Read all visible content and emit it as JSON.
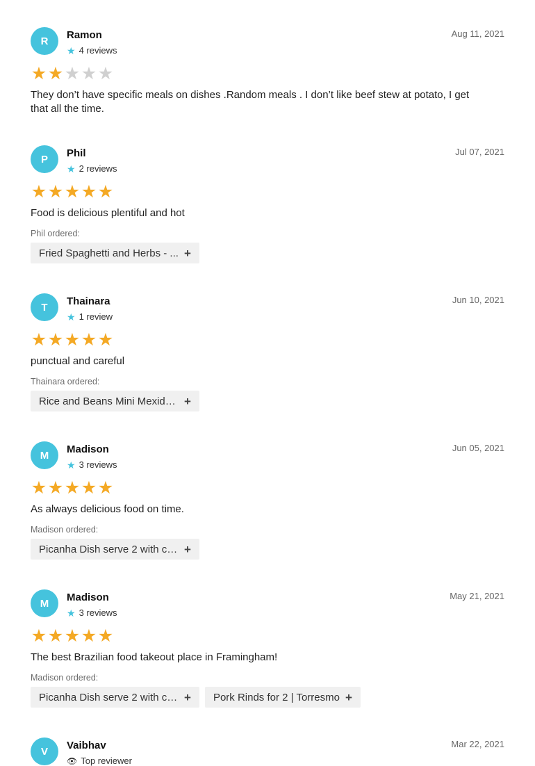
{
  "reviews": [
    {
      "initial": "R",
      "name": "Ramon",
      "meta_icon": "star-icon",
      "meta": "4 reviews",
      "date": "Aug 11, 2021",
      "rating": 2,
      "text": "They don’t have specific meals on dishes .Random meals . I don’t like beef stew at potato, I get that all the time.",
      "ordered_label": "",
      "items": []
    },
    {
      "initial": "P",
      "name": "Phil",
      "meta_icon": "star-icon",
      "meta": "2 reviews",
      "date": "Jul 07, 2021",
      "rating": 5,
      "text": "Food is delicious plentiful and hot",
      "ordered_label": "Phil ordered:",
      "items": [
        {
          "label": "Fried Spaghetti and Herbs - ...",
          "truncated": true
        }
      ]
    },
    {
      "initial": "T",
      "name": "Thainara",
      "meta_icon": "star-icon",
      "meta": "1 review",
      "date": "Jun 10, 2021",
      "rating": 5,
      "text": "punctual and careful",
      "ordered_label": "Thainara ordered:",
      "items": [
        {
          "label": "Rice and Beans Mini Mexidã...",
          "truncated": true
        }
      ]
    },
    {
      "initial": "M",
      "name": "Madison",
      "meta_icon": "star-icon",
      "meta": "3 reviews",
      "date": "Jun 05, 2021",
      "rating": 5,
      "text": "As always delicious food on time.",
      "ordered_label": "Madison ordered:",
      "items": [
        {
          "label": "Picanha Dish serve 2 with ca...",
          "truncated": true
        }
      ]
    },
    {
      "initial": "M",
      "name": "Madison",
      "meta_icon": "star-icon",
      "meta": "3 reviews",
      "date": "May 21, 2021",
      "rating": 5,
      "text": "The best Brazilian food takeout place in Framingham!",
      "ordered_label": "Madison ordered:",
      "items": [
        {
          "label": "Picanha Dish serve 2 with ca...",
          "truncated": true
        },
        {
          "label": "Pork Rinds for 2 | Torresmo",
          "truncated": false
        }
      ]
    },
    {
      "initial": "V",
      "name": "Vaibhav",
      "meta_icon": "eye-icon",
      "meta": "Top reviewer",
      "date": "Mar 22, 2021",
      "rating": 0,
      "text": "",
      "ordered_label": "",
      "items": []
    }
  ],
  "colors": {
    "avatar": "#45c3dd",
    "star_filled": "#f4a925",
    "star_empty": "#d0d0d0",
    "chip_bg": "#f0f0f0"
  }
}
